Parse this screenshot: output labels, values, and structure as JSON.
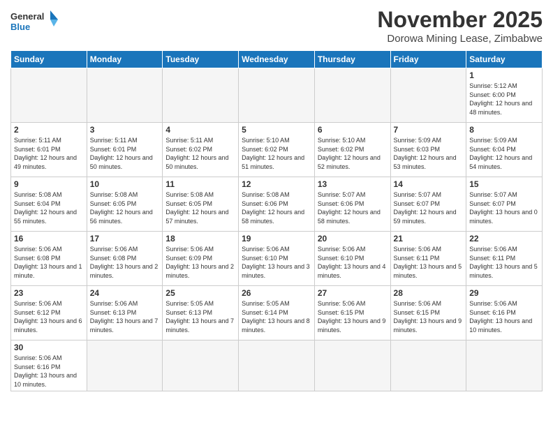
{
  "logo": {
    "text_general": "General",
    "text_blue": "Blue"
  },
  "header": {
    "month_title": "November 2025",
    "subtitle": "Dorowa Mining Lease, Zimbabwe"
  },
  "days_of_week": [
    "Sunday",
    "Monday",
    "Tuesday",
    "Wednesday",
    "Thursday",
    "Friday",
    "Saturday"
  ],
  "weeks": [
    [
      {
        "day": "",
        "info": ""
      },
      {
        "day": "",
        "info": ""
      },
      {
        "day": "",
        "info": ""
      },
      {
        "day": "",
        "info": ""
      },
      {
        "day": "",
        "info": ""
      },
      {
        "day": "",
        "info": ""
      },
      {
        "day": "1",
        "info": "Sunrise: 5:12 AM\nSunset: 6:00 PM\nDaylight: 12 hours\nand 48 minutes."
      }
    ],
    [
      {
        "day": "2",
        "info": "Sunrise: 5:11 AM\nSunset: 6:01 PM\nDaylight: 12 hours\nand 49 minutes."
      },
      {
        "day": "3",
        "info": "Sunrise: 5:11 AM\nSunset: 6:01 PM\nDaylight: 12 hours\nand 50 minutes."
      },
      {
        "day": "4",
        "info": "Sunrise: 5:11 AM\nSunset: 6:02 PM\nDaylight: 12 hours\nand 50 minutes."
      },
      {
        "day": "5",
        "info": "Sunrise: 5:10 AM\nSunset: 6:02 PM\nDaylight: 12 hours\nand 51 minutes."
      },
      {
        "day": "6",
        "info": "Sunrise: 5:10 AM\nSunset: 6:02 PM\nDaylight: 12 hours\nand 52 minutes."
      },
      {
        "day": "7",
        "info": "Sunrise: 5:09 AM\nSunset: 6:03 PM\nDaylight: 12 hours\nand 53 minutes."
      },
      {
        "day": "8",
        "info": "Sunrise: 5:09 AM\nSunset: 6:04 PM\nDaylight: 12 hours\nand 54 minutes."
      }
    ],
    [
      {
        "day": "9",
        "info": "Sunrise: 5:08 AM\nSunset: 6:04 PM\nDaylight: 12 hours\nand 55 minutes."
      },
      {
        "day": "10",
        "info": "Sunrise: 5:08 AM\nSunset: 6:05 PM\nDaylight: 12 hours\nand 56 minutes."
      },
      {
        "day": "11",
        "info": "Sunrise: 5:08 AM\nSunset: 6:05 PM\nDaylight: 12 hours\nand 57 minutes."
      },
      {
        "day": "12",
        "info": "Sunrise: 5:08 AM\nSunset: 6:06 PM\nDaylight: 12 hours\nand 58 minutes."
      },
      {
        "day": "13",
        "info": "Sunrise: 5:07 AM\nSunset: 6:06 PM\nDaylight: 12 hours\nand 58 minutes."
      },
      {
        "day": "14",
        "info": "Sunrise: 5:07 AM\nSunset: 6:07 PM\nDaylight: 12 hours\nand 59 minutes."
      },
      {
        "day": "15",
        "info": "Sunrise: 5:07 AM\nSunset: 6:07 PM\nDaylight: 13 hours\nand 0 minutes."
      }
    ],
    [
      {
        "day": "16",
        "info": "Sunrise: 5:06 AM\nSunset: 6:08 PM\nDaylight: 13 hours\nand 1 minute."
      },
      {
        "day": "17",
        "info": "Sunrise: 5:06 AM\nSunset: 6:08 PM\nDaylight: 13 hours\nand 2 minutes."
      },
      {
        "day": "18",
        "info": "Sunrise: 5:06 AM\nSunset: 6:09 PM\nDaylight: 13 hours\nand 2 minutes."
      },
      {
        "day": "19",
        "info": "Sunrise: 5:06 AM\nSunset: 6:10 PM\nDaylight: 13 hours\nand 3 minutes."
      },
      {
        "day": "20",
        "info": "Sunrise: 5:06 AM\nSunset: 6:10 PM\nDaylight: 13 hours\nand 4 minutes."
      },
      {
        "day": "21",
        "info": "Sunrise: 5:06 AM\nSunset: 6:11 PM\nDaylight: 13 hours\nand 5 minutes."
      },
      {
        "day": "22",
        "info": "Sunrise: 5:06 AM\nSunset: 6:11 PM\nDaylight: 13 hours\nand 5 minutes."
      }
    ],
    [
      {
        "day": "23",
        "info": "Sunrise: 5:06 AM\nSunset: 6:12 PM\nDaylight: 13 hours\nand 6 minutes."
      },
      {
        "day": "24",
        "info": "Sunrise: 5:06 AM\nSunset: 6:13 PM\nDaylight: 13 hours\nand 7 minutes."
      },
      {
        "day": "25",
        "info": "Sunrise: 5:05 AM\nSunset: 6:13 PM\nDaylight: 13 hours\nand 7 minutes."
      },
      {
        "day": "26",
        "info": "Sunrise: 5:05 AM\nSunset: 6:14 PM\nDaylight: 13 hours\nand 8 minutes."
      },
      {
        "day": "27",
        "info": "Sunrise: 5:06 AM\nSunset: 6:15 PM\nDaylight: 13 hours\nand 9 minutes."
      },
      {
        "day": "28",
        "info": "Sunrise: 5:06 AM\nSunset: 6:15 PM\nDaylight: 13 hours\nand 9 minutes."
      },
      {
        "day": "29",
        "info": "Sunrise: 5:06 AM\nSunset: 6:16 PM\nDaylight: 13 hours\nand 10 minutes."
      }
    ],
    [
      {
        "day": "30",
        "info": "Sunrise: 5:06 AM\nSunset: 6:16 PM\nDaylight: 13 hours\nand 10 minutes."
      },
      {
        "day": "",
        "info": ""
      },
      {
        "day": "",
        "info": ""
      },
      {
        "day": "",
        "info": ""
      },
      {
        "day": "",
        "info": ""
      },
      {
        "day": "",
        "info": ""
      },
      {
        "day": "",
        "info": ""
      }
    ]
  ]
}
